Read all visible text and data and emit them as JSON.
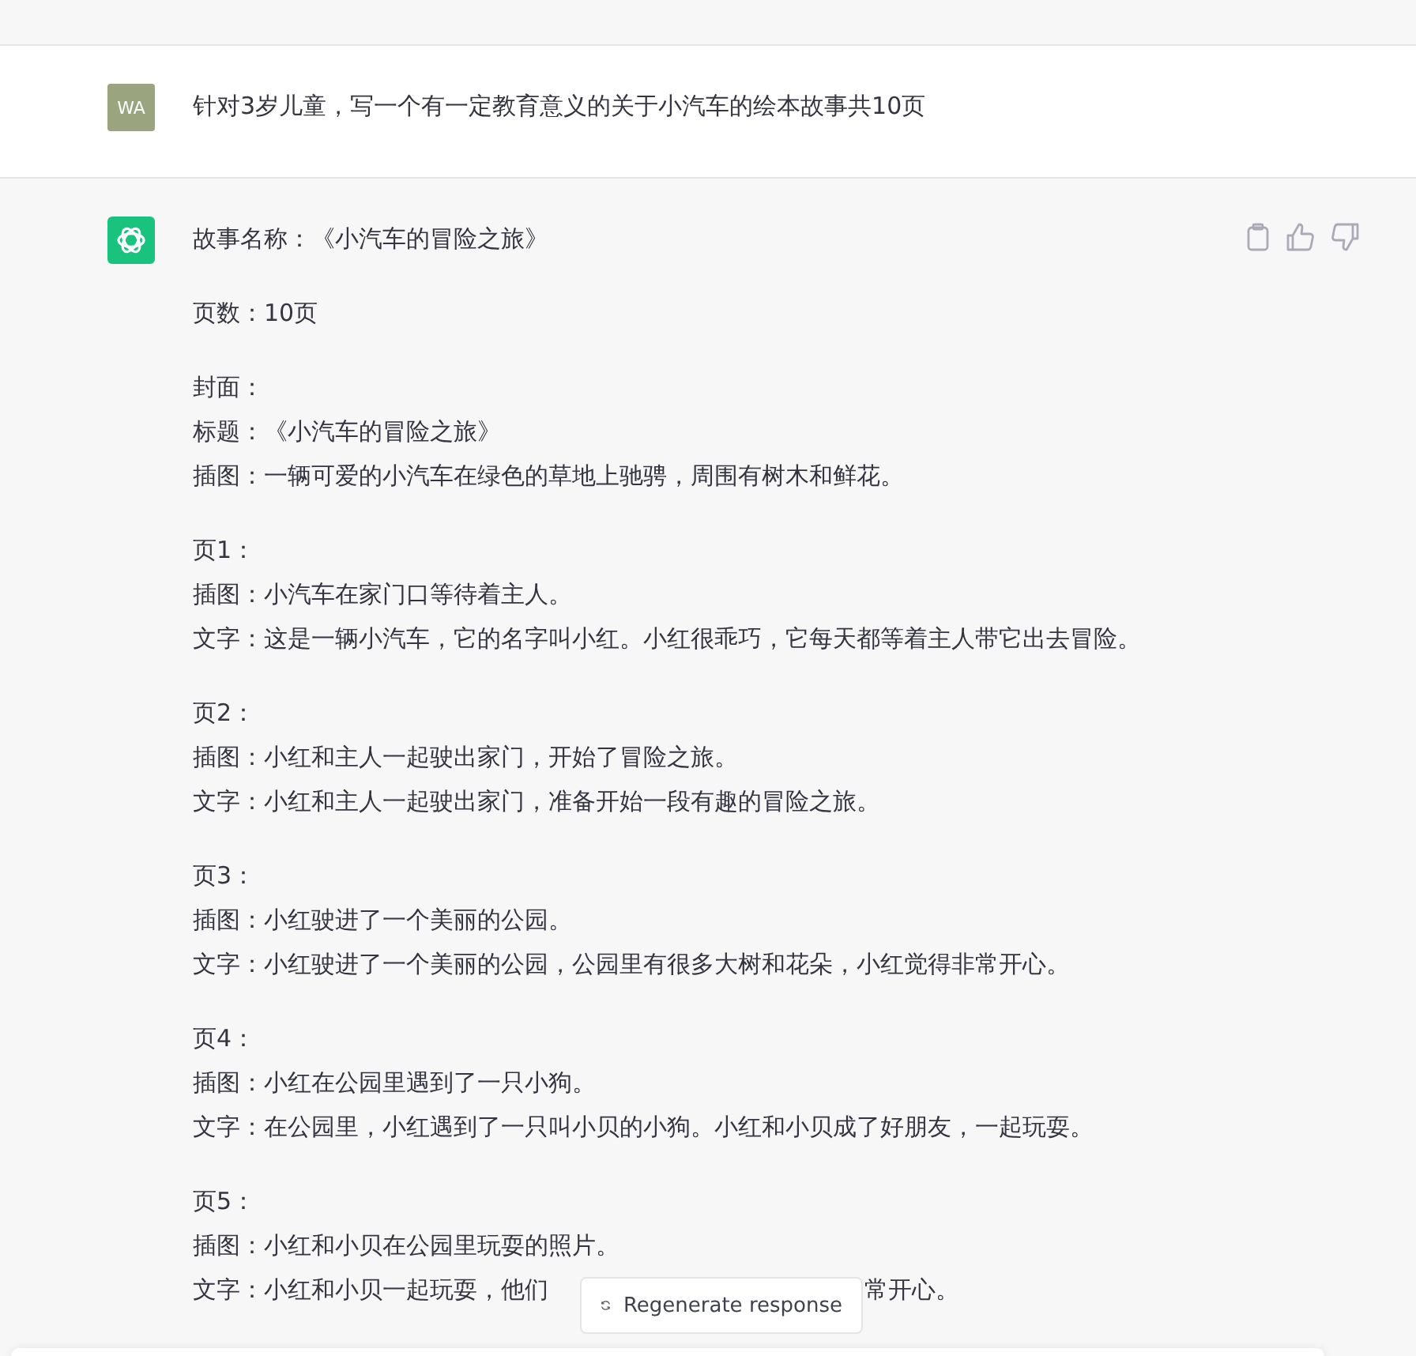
{
  "user_message": {
    "avatar": "WA",
    "text": "针对3岁儿童，写一个有一定教育意义的关于小汽车的绘本故事共10页"
  },
  "assistant_message": {
    "paragraphs": [
      {
        "lines": [
          {
            "kind": "text",
            "text": "故事名称：《小汽车的冒险之旅》"
          }
        ]
      },
      {
        "lines": [
          {
            "kind": "text",
            "text": "页数：10页"
          }
        ]
      },
      {
        "lines": [
          {
            "kind": "text",
            "text": "封面："
          },
          {
            "kind": "text",
            "text": "标题：《小汽车的冒险之旅》"
          },
          {
            "kind": "text",
            "text": "插图：一辆可爱的小汽车在绿色的草地上驰骋，周围有树木和鲜花。"
          }
        ]
      },
      {
        "lines": [
          {
            "kind": "text",
            "text": "页1："
          },
          {
            "kind": "text",
            "text": "插图：小汽车在家门口等待着主人。"
          },
          {
            "kind": "text",
            "text": "文字：这是一辆小汽车，它的名字叫小红。小红很乖巧，它每天都等着主人带它出去冒险。"
          }
        ]
      },
      {
        "lines": [
          {
            "kind": "text",
            "text": "页2："
          },
          {
            "kind": "text",
            "text": "插图：小红和主人一起驶出家门，开始了冒险之旅。"
          },
          {
            "kind": "text",
            "text": "文字：小红和主人一起驶出家门，准备开始一段有趣的冒险之旅。"
          }
        ]
      },
      {
        "lines": [
          {
            "kind": "text",
            "text": "页3："
          },
          {
            "kind": "text",
            "text": "插图：小红驶进了一个美丽的公园。"
          },
          {
            "kind": "text",
            "text": "文字：小红驶进了一个美丽的公园，公园里有很多大树和花朵，小红觉得非常开心。"
          }
        ]
      },
      {
        "lines": [
          {
            "kind": "text",
            "text": "页4："
          },
          {
            "kind": "text",
            "text": "插图：小红在公园里遇到了一只小狗。"
          },
          {
            "kind": "text",
            "text": "文字：在公园里，小红遇到了一只叫小贝的小狗。小红和小贝成了好朋友，一起玩耍。"
          }
        ]
      },
      {
        "lines": [
          {
            "kind": "text",
            "text": "页5："
          },
          {
            "kind": "text",
            "text": "插图：小红和小贝在公园里玩耍的照片。"
          },
          {
            "kind": "covered",
            "before": "文字：小红和小贝一起玩耍，他们",
            "after": "常开心。"
          }
        ]
      }
    ]
  },
  "regenerate_button": {
    "label": "Regenerate response"
  }
}
